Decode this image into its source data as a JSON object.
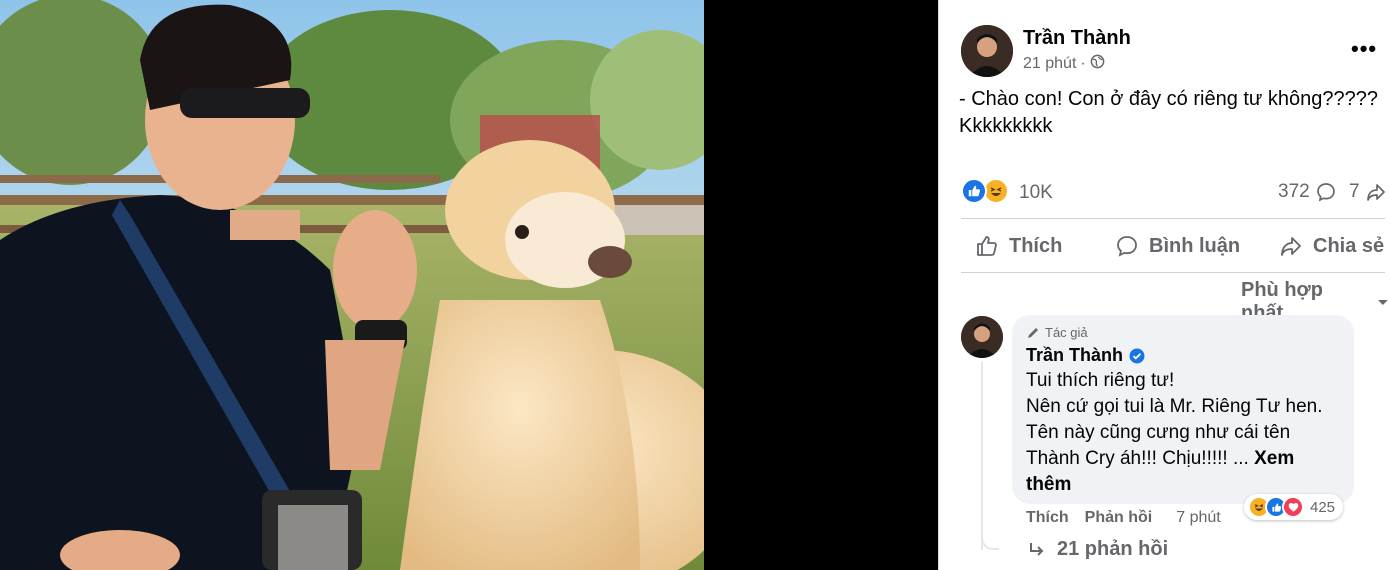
{
  "post": {
    "author": "Trần Thành",
    "time": "21 phút",
    "time_separator": "·",
    "privacy_icon": "globe-icon",
    "text_lines": [
      "- Chào con! Con ở đây có riêng tư không?????",
      "Kkkkkkkkk"
    ]
  },
  "stats": {
    "reactions": "10K",
    "reaction_types": [
      "like",
      "haha"
    ],
    "comments": "372",
    "shares": "7"
  },
  "actions": {
    "like": "Thích",
    "comment": "Bình luận",
    "share": "Chia sẻ"
  },
  "sort": {
    "label": "Phù hợp nhất"
  },
  "comment": {
    "badge": "Tác giả",
    "author": "Trần Thành",
    "verified": true,
    "lines": [
      "Tui thích riêng tư!",
      "Nên cứ gọi tui là Mr. Riêng Tư hen.",
      "Tên này cũng cưng như cái tên",
      "Thành Cry áh!!! Chịu!!!!! ..."
    ],
    "see_more_1": "Xem",
    "see_more_2": "thêm",
    "reaction_count": "425",
    "reaction_types": [
      "haha",
      "like",
      "love"
    ],
    "like": "Thích",
    "reply": "Phản hồi",
    "time": "7 phút",
    "replies": "21 phản hồi"
  },
  "colors": {
    "accent": "#1b74e4",
    "secondary_text": "#65676b",
    "bubble": "#f0f2f5",
    "haha": "#f7b125",
    "love": "#f33e58"
  }
}
